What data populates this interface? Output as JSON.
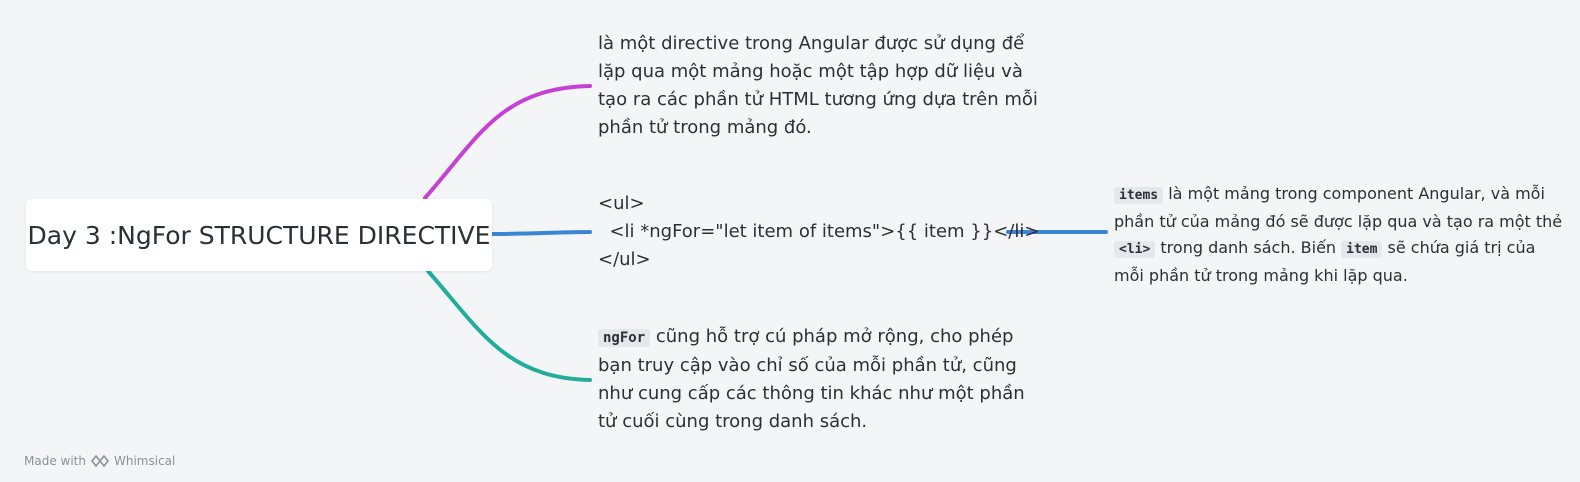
{
  "root": {
    "title": "Day 3 :NgFor STRUCTURE DIRECTIVE"
  },
  "nodes": {
    "top": {
      "text": " là một directive trong Angular được sử dụng để lặp qua một mảng hoặc một tập hợp dữ liệu và tạo ra các phần tử HTML tương ứng dựa trên mỗi phần tử trong mảng đó."
    },
    "middle": {
      "line1": "<ul>",
      "line2": "  <li *ngFor=\"let item of items\">{{ item }}</li>",
      "line3": "</ul>"
    },
    "bottom": {
      "code": "ngFor",
      "text": " cũng hỗ trợ cú pháp mở rộng, cho phép bạn truy cập vào chỉ số của mỗi phần tử, cũng như cung cấp các thông tin khác như một phần tử cuối cùng trong danh sách."
    },
    "right": {
      "code1": "items",
      "text1": " là một mảng trong component Angular, và mỗi phần tử của mảng đó sẽ được lặp qua và tạo ra một thẻ ",
      "code2": "<li>",
      "text2": " trong danh sách. Biến ",
      "code3": "item",
      "text3": " sẽ chứa giá trị của mỗi phần tử trong mảng khi lặp qua."
    }
  },
  "connectors": {
    "top_color": "#c541d6",
    "middle_color": "#3a86d4",
    "bottom_color": "#22ad9b",
    "right_color": "#3a86d4"
  },
  "footer": {
    "made_with": "Made with",
    "brand": "Whimsical",
    "icon": "whimsical-logo-icon"
  }
}
